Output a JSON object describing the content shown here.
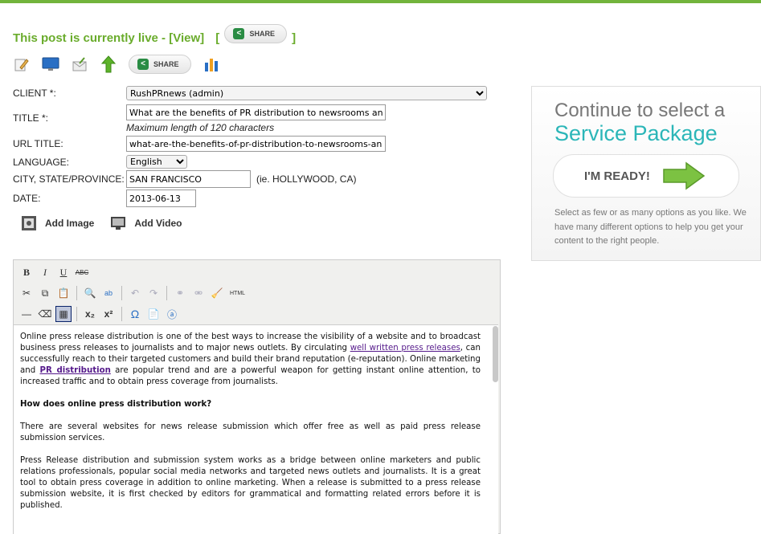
{
  "status": {
    "text": "This post is currently live - ",
    "view_link": "[View]",
    "bracket_open": "[",
    "bracket_close": "]",
    "share_label": "SHARE"
  },
  "toolbar": {
    "share_label": "SHARE",
    "icons": [
      "edit-icon",
      "preview-monitor-icon",
      "send-icon",
      "promote-arrow-icon",
      "share-icon",
      "stats-chart-icon"
    ]
  },
  "form": {
    "client_label": "CLIENT *:",
    "client_value": "RushPRnews (admin)",
    "title_label": "TITLE *:",
    "title_value": "What are the benefits of PR distribution to newsrooms and online",
    "title_hint": "Maximum length of 120 characters",
    "url_label": "URL TITLE:",
    "url_value": "what-are-the-benefits-of-pr-distribution-to-newsrooms-and-online",
    "language_label": "LANGUAGE:",
    "language_value": "English",
    "city_label": "CITY, STATE/PROVINCE:",
    "city_value": "SAN FRANCISCO",
    "city_hint": "(ie. HOLLYWOOD, CA)",
    "date_label": "DATE:",
    "date_value": "2013-06-13"
  },
  "media": {
    "add_image": "Add Image",
    "add_video": "Add Video"
  },
  "editor": {
    "row1": [
      {
        "name": "bold-button",
        "glyph": "B"
      },
      {
        "name": "italic-button",
        "glyph": "I"
      },
      {
        "name": "underline-button",
        "glyph": "U"
      },
      {
        "name": "strikethrough-button",
        "glyph": "ABC"
      }
    ],
    "html_label": "HTML",
    "p1_a": "Online press release distribution is one of the best ways to increase the visibility of a website and to broadcast business press releases to journalists and to major news outlets. By circulating ",
    "p1_link1": "well written press releases",
    "p1_b": ", can successfully reach to their targeted customers and build their brand reputation (e-reputation). Online marketing and ",
    "p1_link2": "PR distribution",
    "p1_c": " are popular trend and are a powerful weapon for getting instant online attention,  to increased traffic and to obtain press coverage from journalists.",
    "h1": "How does online press distribution work?",
    "p2": "There are several websites for news release submission which offer free as well as paid press release submission services.",
    "p3": "Press Release distribution and  submission system works as a bridge between online marketers and public relations professionals, popular social media networks and targeted news outlets and journalists. It is a great tool to obtain press coverage in addition to online marketing. When a release is submitted to a press release submission website, it is first checked by editors for grammatical and formatting related errors before it is published."
  },
  "panel": {
    "line1": "Continue to select a",
    "line2": "Service Package",
    "button": "I'M READY!",
    "description": "Select as few or as many options as you like. We have many different options to help you get your content to the right people."
  },
  "colors": {
    "brand_green": "#6aac2c",
    "teal": "#2bb6b8",
    "arrow_green": "#7cc242"
  }
}
